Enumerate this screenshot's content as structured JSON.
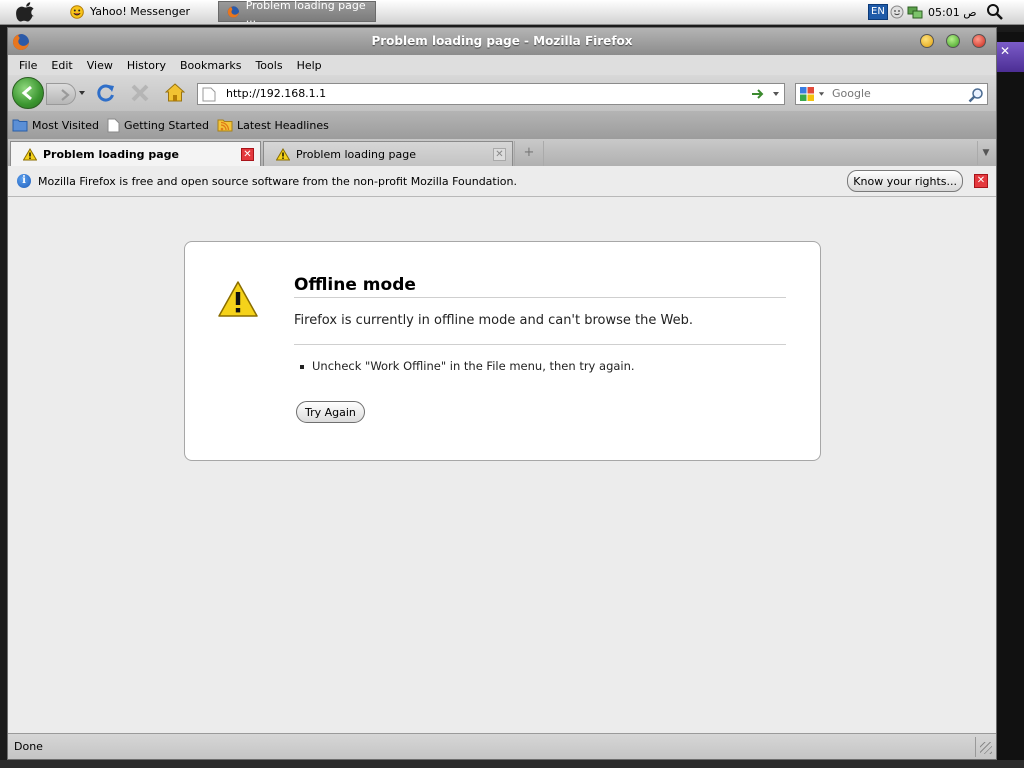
{
  "desktop_panel": {
    "tasks": [
      {
        "label": "Yahoo! Messenger",
        "icon": "smiley-icon"
      },
      {
        "label": "Problem loading page ...",
        "icon": "firefox-icon"
      }
    ],
    "tray": {
      "lang": "EN",
      "time": "05:01",
      "time_suffix": "ص"
    }
  },
  "window": {
    "title": "Problem loading page - Mozilla Firefox"
  },
  "menu": [
    "File",
    "Edit",
    "View",
    "History",
    "Bookmarks",
    "Tools",
    "Help"
  ],
  "menu_mnemonic": [
    "F",
    "E",
    "V",
    "H",
    "B",
    "T",
    "H"
  ],
  "navbar": {
    "url": "http://192.168.1.1",
    "search_placeholder": "Google"
  },
  "bookmarks": [
    {
      "label": "Most Visited",
      "icon": "folder-icon"
    },
    {
      "label": "Getting Started",
      "icon": "page-icon"
    },
    {
      "label": "Latest Headlines",
      "icon": "rss-icon"
    }
  ],
  "tabs": [
    {
      "label": "Problem loading page",
      "active": true
    },
    {
      "label": "Problem loading page",
      "active": false
    }
  ],
  "notification": {
    "message": "Mozilla Firefox is free and open source software from the non-profit Mozilla Foundation.",
    "button": "Know your rights..."
  },
  "error": {
    "title": "Offline mode",
    "description": "Firefox is currently in offline mode and can't browse the Web.",
    "hint": "Uncheck \"Work Offline\" in the File menu, then try again.",
    "button": "Try Again"
  },
  "status": {
    "text": "Done"
  },
  "colors": {
    "accent": "#3b9630",
    "close_red": "#e4393e",
    "warning_yellow": "#f5d21a"
  }
}
